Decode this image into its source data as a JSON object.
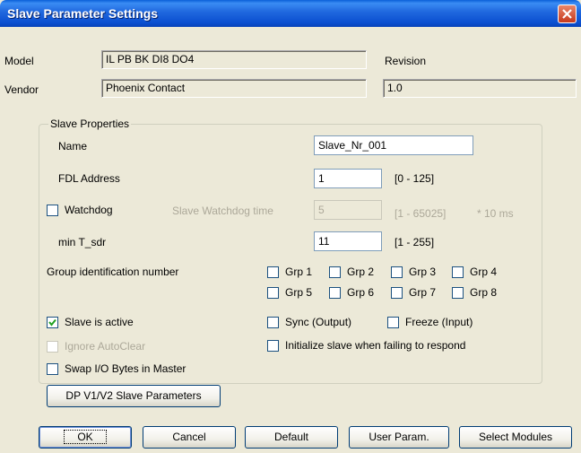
{
  "window": {
    "title": "Slave Parameter Settings"
  },
  "info": {
    "model_label": "Model",
    "model_value": "IL PB BK DI8 DO4",
    "vendor_label": "Vendor",
    "vendor_value": "Phoenix Contact",
    "revision_label": "Revision",
    "revision_value": "1.0"
  },
  "group": {
    "title": "Slave Properties",
    "name_label": "Name",
    "name_value": "Slave_Nr_001",
    "fdl_label": "FDL Address",
    "fdl_value": "1",
    "fdl_range": "[0 - 125]",
    "watchdog_label": "Watchdog",
    "watchdog_checked": false,
    "wd_time_label": "Slave Watchdog time",
    "wd_time_value": "5",
    "wd_time_range": "[1 - 65025]",
    "wd_time_unit": "* 10 ms",
    "tsdr_label": "min T_sdr",
    "tsdr_value": "11",
    "tsdr_range": "[1 - 255]",
    "group_id_label": "Group identification number",
    "groups": [
      {
        "label": "Grp 1",
        "checked": false
      },
      {
        "label": "Grp 2",
        "checked": false
      },
      {
        "label": "Grp 3",
        "checked": false
      },
      {
        "label": "Grp 4",
        "checked": false
      },
      {
        "label": "Grp 5",
        "checked": false
      },
      {
        "label": "Grp 6",
        "checked": false
      },
      {
        "label": "Grp 7",
        "checked": false
      },
      {
        "label": "Grp 8",
        "checked": false
      }
    ],
    "slave_active_label": "Slave is active",
    "slave_active_checked": true,
    "ignore_autoclear_label": "Ignore AutoClear",
    "ignore_autoclear_checked": false,
    "swap_label": "Swap I/O Bytes in Master",
    "swap_checked": false,
    "sync_label": "Sync (Output)",
    "sync_checked": false,
    "freeze_label": "Freeze (Input)",
    "freeze_checked": false,
    "init_label": "Initialize slave when failing to respond",
    "init_checked": false,
    "dp_button": "DP V1/V2 Slave Parameters"
  },
  "buttons": {
    "ok": "OK",
    "cancel": "Cancel",
    "default": "Default",
    "user_param": "User Param.",
    "select_modules": "Select Modules"
  }
}
